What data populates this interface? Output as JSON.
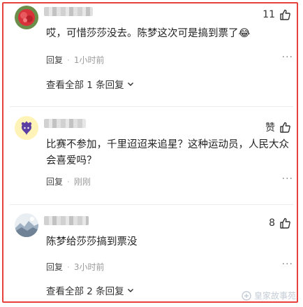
{
  "comments": [
    {
      "likes": "11",
      "text": "哎，可惜莎莎没去。陈梦这次可是搞到票了😂",
      "reply_label": "回复",
      "time": "1小时前",
      "more": "···",
      "view_all": "查看全部 1 条回复"
    },
    {
      "likes": "赞",
      "text": "比赛不参加，千里迢迢来追星？这种运动员，人民大众会喜爱吗？",
      "reply_label": "回复",
      "time": "刚刚",
      "more": "···"
    },
    {
      "likes": "8",
      "text": "陈梦给莎莎搞到票没",
      "reply_label": "回复",
      "time": "3小时前",
      "more": "···",
      "view_all": "查看全部 2 条回复"
    }
  ],
  "watermark": "皇家故事苑",
  "colors": {
    "frame": "#e8413c",
    "muted": "#9a9a9a"
  }
}
